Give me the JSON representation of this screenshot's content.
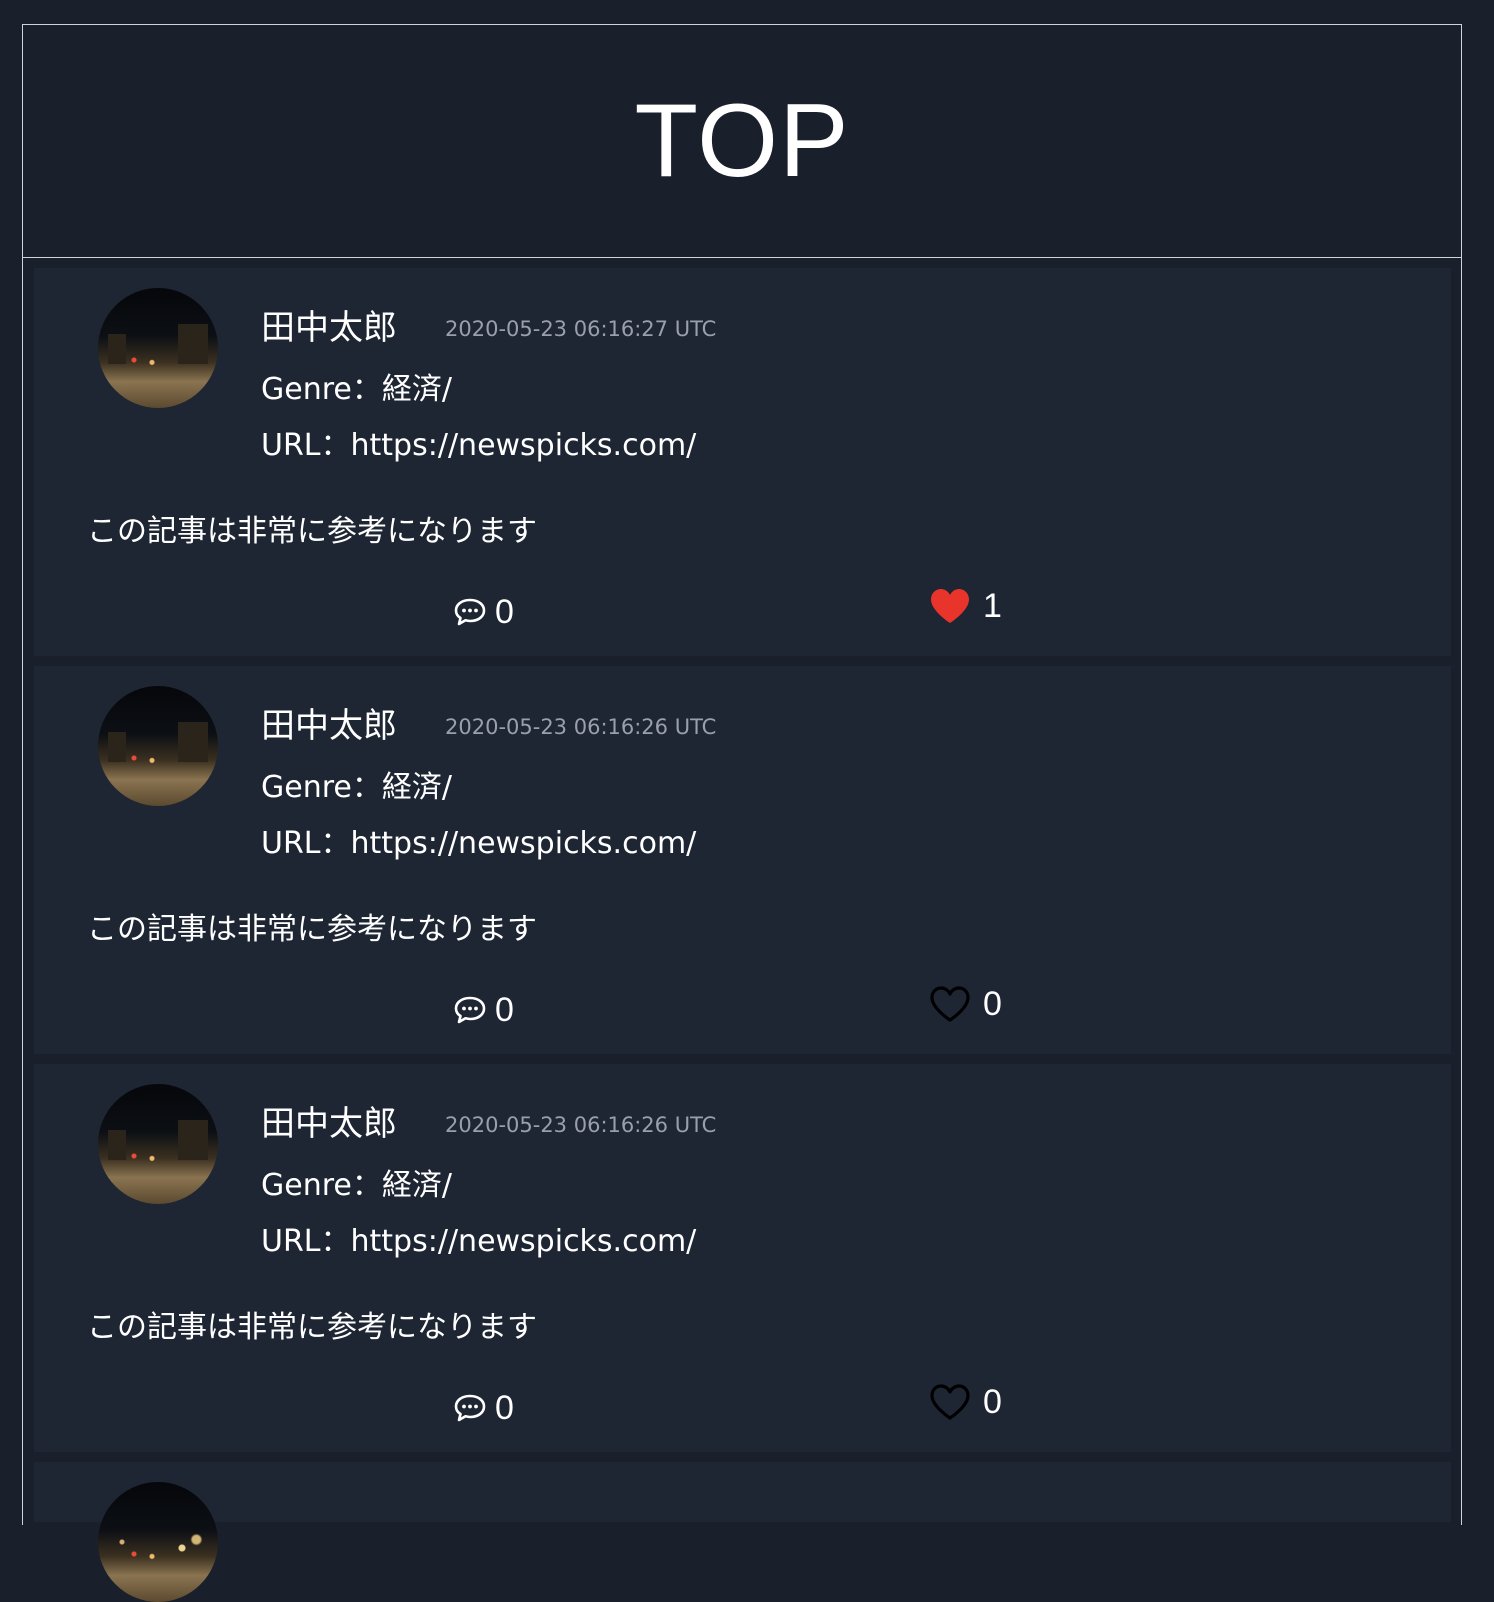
{
  "page": {
    "title": "TOP"
  },
  "posts": [
    {
      "author": "田中太郎",
      "timestamp": "2020-05-23 06:16:27 UTC",
      "genre": "Genre：経済/",
      "url": "URL：https://newspicks.com/",
      "body": "この記事は非常に参考になります",
      "comment_count": "0",
      "like_count": "1",
      "liked": true
    },
    {
      "author": "田中太郎",
      "timestamp": "2020-05-23 06:16:26 UTC",
      "genre": "Genre：経済/",
      "url": "URL：https://newspicks.com/",
      "body": "この記事は非常に参考になります",
      "comment_count": "0",
      "like_count": "0",
      "liked": false
    },
    {
      "author": "田中太郎",
      "timestamp": "2020-05-23 06:16:26 UTC",
      "genre": "Genre：経済/",
      "url": "URL：https://newspicks.com/",
      "body": "この記事は非常に参考になります",
      "comment_count": "0",
      "like_count": "0",
      "liked": false
    }
  ],
  "icons": {
    "comment": "speech-bubble-icon",
    "like_filled": "heart-filled-icon",
    "like_outline": "heart-outline-icon"
  },
  "colors": {
    "background": "#1a1f2c",
    "card": "#1e2533",
    "border": "#cfd3da",
    "like_active": "#e8342a",
    "timestamp": "#9aa0ab"
  }
}
